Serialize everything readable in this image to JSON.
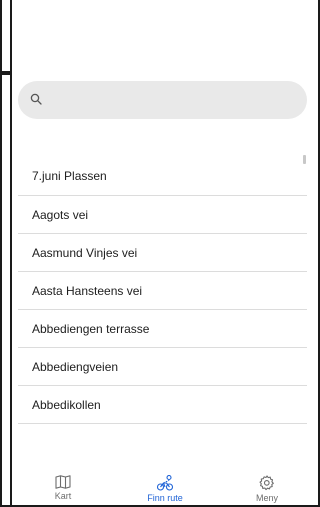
{
  "search": {
    "placeholder": "",
    "icon": "search-icon"
  },
  "streets": [
    "7.juni Plassen",
    "Aagots vei",
    "Aasmund Vinjes vei",
    "Aasta Hansteens vei",
    "Abbediengen terrasse",
    "Abbediengveien",
    "Abbedikollen"
  ],
  "nav": {
    "items": [
      {
        "label": "Kart",
        "icon": "map-icon",
        "active": false
      },
      {
        "label": "Finn rute",
        "icon": "route-icon",
        "active": true
      },
      {
        "label": "Meny",
        "icon": "gear-icon",
        "active": false
      }
    ]
  },
  "colors": {
    "accent": "#1f63d6",
    "inactive": "#6d6d6d",
    "search_bg": "#e9e9e9"
  }
}
